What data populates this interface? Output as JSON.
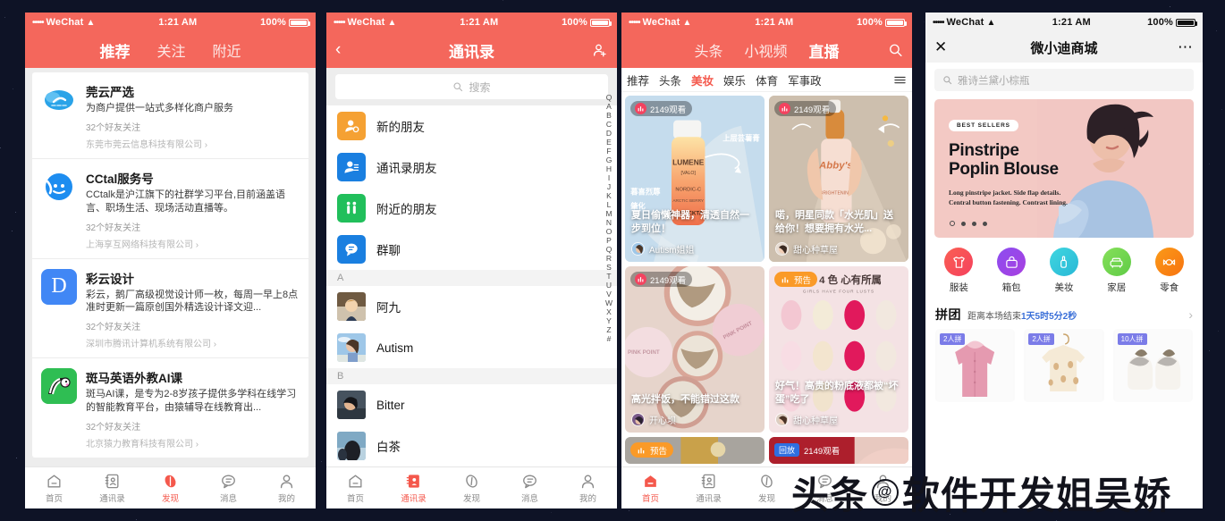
{
  "background": {
    "color": "#0e1326"
  },
  "watermark": {
    "prefix": "头条",
    "handle": "软件开发姐吴娇",
    "copy": "@"
  },
  "status_bar": {
    "carrier": "WeChat",
    "dots": "•••••",
    "time": "1:21 AM",
    "battery": "100%"
  },
  "panel1": {
    "name": "wechat-discover-official-accounts",
    "nav_tabs": [
      {
        "label": "推荐",
        "active": true
      },
      {
        "label": "关注",
        "active": false
      },
      {
        "label": "附近",
        "active": false
      }
    ],
    "accounts": [
      {
        "name": "莞云严选",
        "desc": "为商户提供一站式多样化商户服务",
        "friends": "32个好友关注",
        "corp": "东莞市莞云信息科技有限公司",
        "logo": "cloud-icon",
        "logo_color": "#1a9cf0"
      },
      {
        "name": "CCtal服务号",
        "desc": "CCtalk是沪江旗下的社群学习平台,目前涵盖语言、职场生活、现场活动直播等。",
        "friends": "32个好友关注",
        "corp": "上海享互网络科技有限公司",
        "logo": "smiley-icon",
        "logo_color": "#1d8df0"
      },
      {
        "name": "彩云设计",
        "desc": "彩云，鹅厂高级视觉设计师一枚，每周一早上8点准时更新一篇原创国外精选设计译文迎...",
        "friends": "32个好友关注",
        "corp": "深圳市腾讯计算机系统有限公司",
        "logo": "letter-d-icon",
        "logo_color": "#4187f5"
      },
      {
        "name": "斑马英语外教AI课",
        "desc": "斑马AI课，是专为2-8岁孩子提供多学科在线学习的智能教育平台，由猿辅导在线教育出...",
        "friends": "32个好友关注",
        "corp": "北京猿力教育科技有限公司",
        "logo": "zebra-icon",
        "logo_color": "#2fbe53"
      }
    ],
    "tabbar": [
      {
        "label": "首页",
        "icon": "home-icon",
        "active": false
      },
      {
        "label": "通讯录",
        "icon": "contacts-icon",
        "active": false
      },
      {
        "label": "发现",
        "icon": "discover-icon",
        "active": true
      },
      {
        "label": "消息",
        "icon": "message-icon",
        "active": false
      },
      {
        "label": "我的",
        "icon": "profile-icon",
        "active": false
      }
    ]
  },
  "panel2": {
    "name": "wechat-contacts",
    "nav_title": "通讯录",
    "back_icon": "chevron-left-icon",
    "add_icon": "add-contact-icon",
    "search_placeholder": "搜索",
    "search_icon": "search-icon",
    "entries": [
      {
        "label": "新的朋友",
        "icon": "new-friend-icon",
        "color": "#f5a133"
      },
      {
        "label": "通讯录朋友",
        "icon": "phone-contacts-icon",
        "color": "#1a7fe0"
      },
      {
        "label": "附近的朋友",
        "icon": "nearby-friends-icon",
        "color": "#21bf5b"
      },
      {
        "label": "群聊",
        "icon": "group-chat-icon",
        "color": "#1a7fe0"
      }
    ],
    "sections": [
      {
        "letter": "A",
        "contacts": [
          "阿九",
          "Autism"
        ]
      },
      {
        "letter": "B",
        "contacts": [
          "Bitter",
          "白茶"
        ]
      }
    ],
    "index_letters": [
      "Q",
      "A",
      "B",
      "C",
      "D",
      "E",
      "F",
      "G",
      "H",
      "I",
      "J",
      "K",
      "L",
      "M",
      "N",
      "O",
      "P",
      "Q",
      "R",
      "S",
      "T",
      "U",
      "V",
      "W",
      "X",
      "Y",
      "Z",
      "#"
    ],
    "tabbar": [
      {
        "label": "首页",
        "icon": "home-icon",
        "active": false
      },
      {
        "label": "通讯录",
        "icon": "contacts-icon",
        "active": true
      },
      {
        "label": "发现",
        "icon": "discover-icon",
        "active": false
      },
      {
        "label": "消息",
        "icon": "message-icon",
        "active": false
      },
      {
        "label": "我的",
        "icon": "profile-icon",
        "active": false
      }
    ]
  },
  "panel3": {
    "name": "live-stream-feed",
    "nav_tabs": [
      {
        "label": "头条",
        "active": false
      },
      {
        "label": "小视频",
        "active": false
      },
      {
        "label": "直播",
        "active": true
      }
    ],
    "search_icon": "search-icon",
    "sub_tabs": [
      {
        "label": "推荐",
        "active": false
      },
      {
        "label": "头条",
        "active": false
      },
      {
        "label": "美妆",
        "active": true
      },
      {
        "label": "娱乐",
        "active": false
      },
      {
        "label": "体育",
        "active": false
      },
      {
        "label": "军事政",
        "active": false
      }
    ],
    "menu_icon": "hamburger-icon",
    "cards": [
      {
        "badge": "2149观看",
        "badge_type": "dark",
        "title": "夏日偷懒神器，清透自然一步到位！",
        "author": "Autism姐姐",
        "theme": "serum-blue"
      },
      {
        "badge": "2149观看",
        "badge_type": "dark",
        "title": "喏，明星同款「水光肌」送给你！想要拥有水光...",
        "author": "甜心种草屋",
        "theme": "dropper-beige"
      },
      {
        "badge": "2149观看",
        "badge_type": "dark",
        "title": "高光拌饭，不能错过这款",
        "author": "开心坝",
        "theme": "powder-pink"
      },
      {
        "badge": "预告",
        "badge_type": "orange",
        "title": "好气！高贵的粉底液都被“坏蛋”吃了",
        "author": "甜心种草屋",
        "theme": "sponge-pink",
        "overlay_title": "少女4色 心有所属",
        "overlay_sub": "GIRLS HAVE FOUR LUSTS"
      },
      {
        "badge": "预告",
        "badge_type": "orange",
        "title": "",
        "author": "",
        "theme": "gold-grey"
      },
      {
        "badge": "2149观看",
        "badge_type": "blue",
        "badge_label": "回放",
        "title": "",
        "author": "",
        "theme": "red-hand"
      }
    ],
    "tabbar": [
      {
        "label": "首页",
        "icon": "home-icon",
        "active": true
      },
      {
        "label": "通讯录",
        "icon": "contacts-icon",
        "active": false
      },
      {
        "label": "发现",
        "icon": "discover-icon",
        "active": false
      },
      {
        "label": "消息",
        "icon": "message-icon",
        "active": false
      },
      {
        "label": "我的",
        "icon": "profile-icon",
        "active": false
      }
    ]
  },
  "panel4": {
    "name": "mini-program-mall",
    "nav_title": "微小迪商城",
    "close_icon": "close-icon",
    "more_icon": "more-dots-icon",
    "search_placeholder": "雅诗兰黛小棕瓶",
    "search_icon": "search-icon",
    "banner": {
      "pill": "BEST SELLERS",
      "heading_line1": "Pinstripe",
      "heading_line2": "Poplin Blouse",
      "body": "Long pinstripe jacket. Side flap details. Central button fastening. Contrast lining.",
      "dots": 4,
      "active_dot": 0,
      "bg_color": "#f2c7c3"
    },
    "categories": [
      {
        "label": "服装",
        "icon": "tshirt-icon",
        "color": "#f5525f"
      },
      {
        "label": "箱包",
        "icon": "bag-icon",
        "color": "#9a46e8"
      },
      {
        "label": "美妆",
        "icon": "cosmetics-icon",
        "color": "#2fc6d8"
      },
      {
        "label": "家居",
        "icon": "sofa-icon",
        "color": "#6ed44f"
      },
      {
        "label": "零食",
        "icon": "candy-icon",
        "color": "#fa8413"
      }
    ],
    "group_buy": {
      "title": "拼团",
      "subtitle_prefix": "距离本场结束",
      "countdown": "1天5时5分2秒",
      "arrow_icon": "chevron-right-icon"
    },
    "products": [
      {
        "label": "2人拼",
        "theme": "pink-jacket"
      },
      {
        "label": "2人拼",
        "theme": "cream-sweater"
      },
      {
        "label": "10人拼",
        "theme": "white-shoes"
      }
    ]
  }
}
